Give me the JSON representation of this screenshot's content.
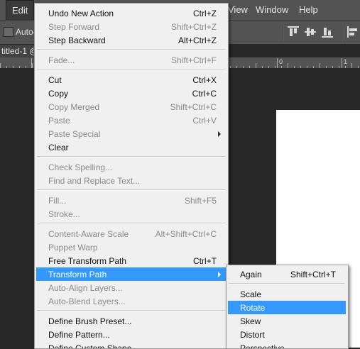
{
  "menubar": {
    "edit": "Edit",
    "view": "View",
    "window": "Window",
    "help": "Help"
  },
  "options": {
    "auto_label": "Auto-"
  },
  "document": {
    "tab_title": "titled-1 @"
  },
  "ruler": {
    "labels": [
      "0",
      "1"
    ]
  },
  "edit_menu": {
    "undo": {
      "label": "Undo New Action",
      "shortcut": "Ctrl+Z"
    },
    "step_forward": {
      "label": "Step Forward",
      "shortcut": "Shift+Ctrl+Z"
    },
    "step_backward": {
      "label": "Step Backward",
      "shortcut": "Alt+Ctrl+Z"
    },
    "fade": {
      "label": "Fade...",
      "shortcut": "Shift+Ctrl+F"
    },
    "cut": {
      "label": "Cut",
      "shortcut": "Ctrl+X"
    },
    "copy": {
      "label": "Copy",
      "shortcut": "Ctrl+C"
    },
    "copy_merged": {
      "label": "Copy Merged",
      "shortcut": "Shift+Ctrl+C"
    },
    "paste": {
      "label": "Paste",
      "shortcut": "Ctrl+V"
    },
    "paste_special": {
      "label": "Paste Special"
    },
    "clear": {
      "label": "Clear"
    },
    "check_spelling": {
      "label": "Check Spelling..."
    },
    "find_replace": {
      "label": "Find and Replace Text..."
    },
    "fill": {
      "label": "Fill...",
      "shortcut": "Shift+F5"
    },
    "stroke": {
      "label": "Stroke..."
    },
    "content_aware_scale": {
      "label": "Content-Aware Scale",
      "shortcut": "Alt+Shift+Ctrl+C"
    },
    "puppet_warp": {
      "label": "Puppet Warp"
    },
    "free_transform_path": {
      "label": "Free Transform Path",
      "shortcut": "Ctrl+T"
    },
    "transform_path": {
      "label": "Transform Path"
    },
    "auto_align": {
      "label": "Auto-Align Layers..."
    },
    "auto_blend": {
      "label": "Auto-Blend Layers..."
    },
    "define_brush": {
      "label": "Define Brush Preset..."
    },
    "define_pattern": {
      "label": "Define Pattern..."
    },
    "define_custom_shape": {
      "label": "Define Custom Shape..."
    }
  },
  "transform_submenu": {
    "again": {
      "label": "Again",
      "shortcut": "Shift+Ctrl+T"
    },
    "scale": {
      "label": "Scale"
    },
    "rotate": {
      "label": "Rotate"
    },
    "skew": {
      "label": "Skew"
    },
    "distort": {
      "label": "Distort"
    },
    "perspective": {
      "label": "Perspective"
    }
  },
  "colors": {
    "highlight": "#3399ff",
    "chrome": "#535353",
    "menu_bg": "#f0f0f0"
  }
}
